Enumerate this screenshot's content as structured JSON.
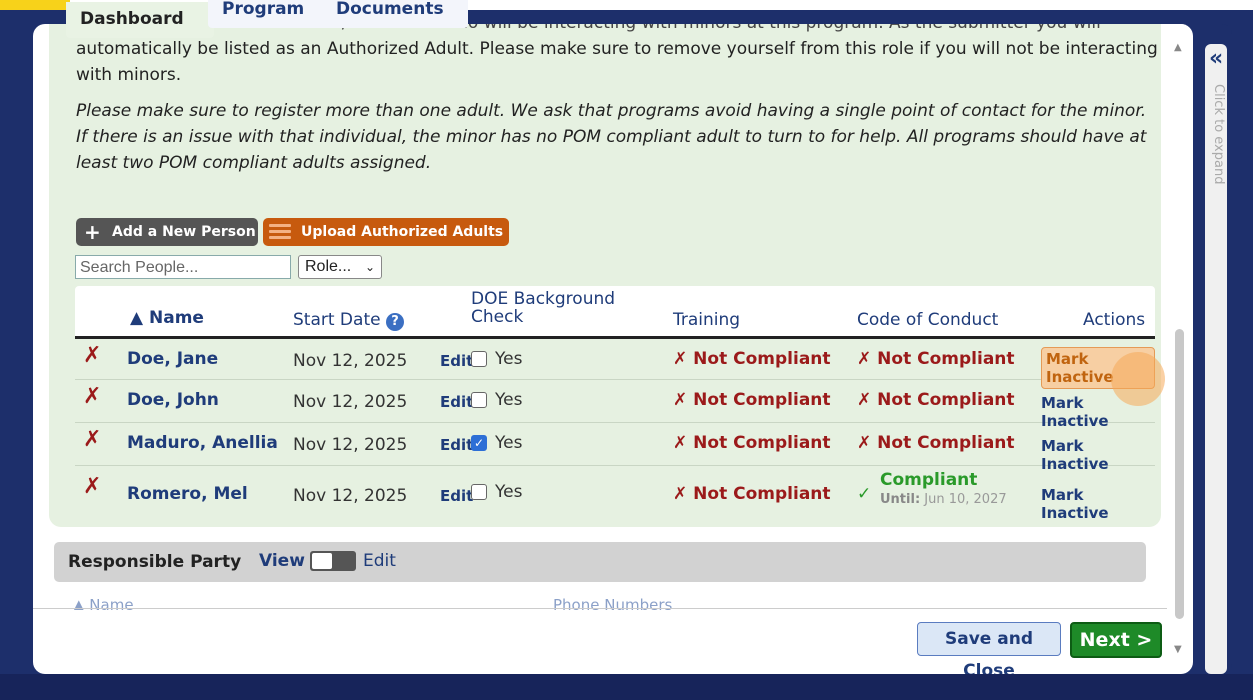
{
  "tabs": [
    {
      "label": "Dashboard",
      "active": true
    },
    {
      "label": "Program",
      "active": false
    },
    {
      "label": "Documents",
      "active": false
    }
  ],
  "intro": {
    "cut_line": "Please add/select all adult staff/volunteers who will be interacting with minors at this program. As the submitter you will",
    "paragraph1": "automatically be listed as an Authorized Adult. Please make sure to remove yourself from this role if you will not be interacting with minors.",
    "paragraph2": "Please make sure to register more than one adult.  We ask that programs avoid having a single point of contact for the minor. If there is an issue with that individual, the minor has no POM compliant adult to turn to for help. All programs should have at least two POM compliant adults assigned."
  },
  "toolbar": {
    "add_label": "Add a New Person",
    "upload_label": "Upload Authorized Adults"
  },
  "filters": {
    "search_placeholder": "Search People...",
    "role_value": "Role..."
  },
  "table": {
    "headers": {
      "name": "▲ Name",
      "start_date": "Start Date",
      "doe_line1": "DOE Background",
      "doe_line2": "Check",
      "training": "Training",
      "code": "Code of Conduct",
      "actions": "Actions"
    },
    "rows": [
      {
        "name": "Doe, Jane",
        "date": "Nov 12, 2025",
        "edit": "Edit",
        "doe_checked": false,
        "doe_label": "Yes",
        "training": "Not Compliant",
        "code": "Not Compliant",
        "code_until_label": "",
        "code_until": "",
        "action": "Mark Inactive"
      },
      {
        "name": "Doe, John",
        "date": "Nov 12, 2025",
        "edit": "Edit",
        "doe_checked": false,
        "doe_label": "Yes",
        "training": "Not Compliant",
        "code": "Not Compliant",
        "code_until_label": "",
        "code_until": "",
        "action": "Mark Inactive"
      },
      {
        "name": "Maduro, Anellia",
        "date": "Nov 12, 2025",
        "edit": "Edit",
        "doe_checked": true,
        "doe_label": "Yes",
        "training": "Not Compliant",
        "code": "Not Compliant",
        "code_until_label": "",
        "code_until": "",
        "action": "Mark Inactive"
      },
      {
        "name": "Romero, Mel",
        "date": "Nov 12, 2025",
        "edit": "Edit",
        "doe_checked": false,
        "doe_label": "Yes",
        "training": "Not Compliant",
        "code": "Compliant",
        "code_until_label": "Until:",
        "code_until": "Jun 10, 2027",
        "action": "Mark Inactive"
      }
    ]
  },
  "responsible_party": {
    "title": "Responsible Party",
    "view_label": "View",
    "edit_label": "Edit",
    "cut_col1": "▲ Name",
    "cut_col2": "Phone Numbers"
  },
  "footer": {
    "save_label": "Save and Close",
    "next_label": "Next >"
  },
  "side_panel": {
    "expand_label": "Click to expand",
    "chevron": "«"
  },
  "colors": {
    "green_panel": "#e6f1e1",
    "navy": "#1f3c7a",
    "not_compliant": "#9b1a1a",
    "compliant": "#2a9a2a",
    "next_green": "#1e8a28",
    "orange": "#c75a0e"
  },
  "icons": [
    "help-icon",
    "x-mark-icon",
    "check-icon",
    "plus-icon",
    "list-icon",
    "chevron-down-icon",
    "double-chevron-left-icon"
  ]
}
